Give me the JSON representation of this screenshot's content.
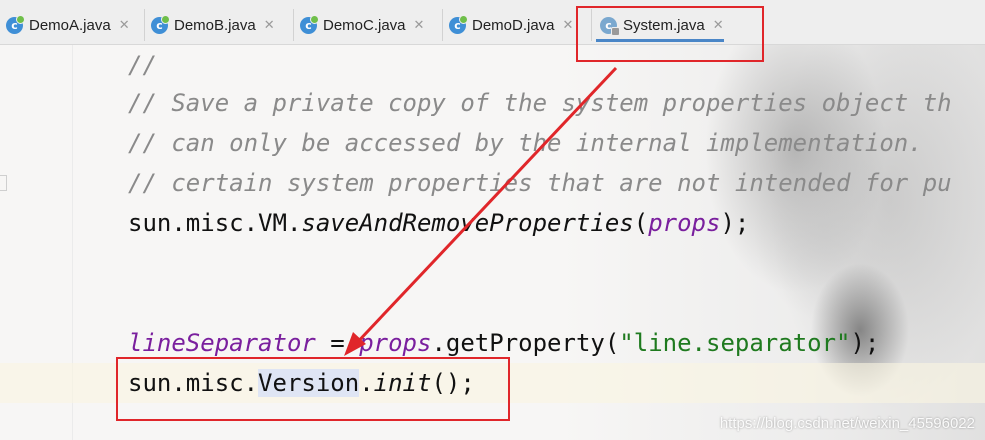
{
  "tabs": [
    {
      "label": "DemoA.java",
      "icon": "java-class-icon"
    },
    {
      "label": "DemoB.java",
      "icon": "java-class-icon"
    },
    {
      "label": "DemoC.java",
      "icon": "java-class-icon"
    },
    {
      "label": "DemoD.java",
      "icon": "java-class-icon"
    },
    {
      "label": "System.java",
      "icon": "java-class-readonly-icon",
      "active": true
    }
  ],
  "tab_close_glyph": "✕",
  "code": {
    "line1": "//",
    "line2": "// Save a private copy of the system properties object th",
    "line3": "// can only be accessed by the internal implementation.  ",
    "line4": "// certain system properties that are not intended for pu",
    "line5": {
      "prefix": "sun.misc.VM.",
      "method": "saveAndRemoveProperties",
      "open": "(",
      "arg": "props",
      "close": ");"
    },
    "line6": {
      "field": "lineSeparator",
      "assign": " = ",
      "obj": "props",
      "call": ".getProperty(",
      "str": "\"line.separator\"",
      "end": ");"
    },
    "line7": {
      "prefix": "sun.misc.",
      "cls": "Version",
      "dot": ".",
      "method": "init",
      "end": "();"
    }
  },
  "watermark": "https://blog.csdn.net/weixin_45596022",
  "colors": {
    "annotation": "#e0262a",
    "comment": "#8a8a8a",
    "field": "#7a1f9e",
    "string": "#1f7a1f",
    "tab_underline": "#4a86c7"
  }
}
